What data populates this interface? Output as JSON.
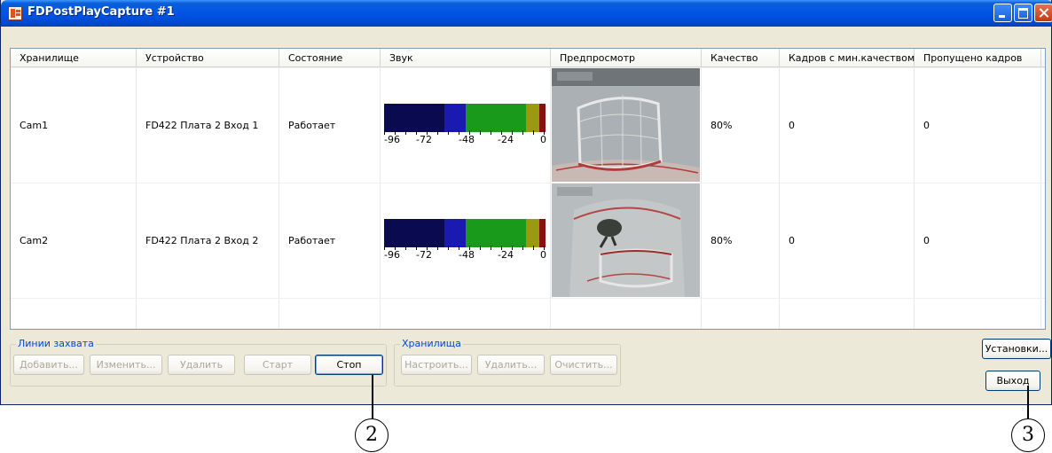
{
  "window": {
    "title": "FDPostPlayCapture #1"
  },
  "table": {
    "headers": [
      "Хранилище",
      "Устройство",
      "Состояние",
      "Звук",
      "Предпросмотр",
      "Качество",
      "Кадров с мин.качеством",
      "Пропущено кадров"
    ],
    "rows": [
      {
        "storage": "Cam1",
        "device": "FD422 Плата 2 Вход 1",
        "state": "Работает",
        "quality": "80%",
        "minq_frames": "0",
        "dropped": "0"
      },
      {
        "storage": "Cam2",
        "device": "FD422 Плата 2 Вход 2",
        "state": "Работает",
        "quality": "80%",
        "minq_frames": "0",
        "dropped": "0"
      }
    ],
    "meter_scale": [
      "-96",
      "-72",
      "-48",
      "-24",
      "0"
    ],
    "meter_colors": [
      "#0a0a50",
      "#1a1ab0",
      "#1a9a1a",
      "#9a9a10",
      "#8a1010"
    ]
  },
  "capture_lines": {
    "title": "Линии захвата",
    "add_label": "Добавить...",
    "edit_label": "Изменить...",
    "delete_label": "Удалить",
    "start_label": "Старт",
    "stop_label": "Стоп"
  },
  "storages": {
    "title": "Хранилища",
    "configure_label": "Настроить...",
    "delete_label": "Удалить...",
    "clear_label": "Очистить..."
  },
  "settings_label": "Установки...",
  "exit_label": "Выход",
  "callouts": [
    "2",
    "3"
  ]
}
